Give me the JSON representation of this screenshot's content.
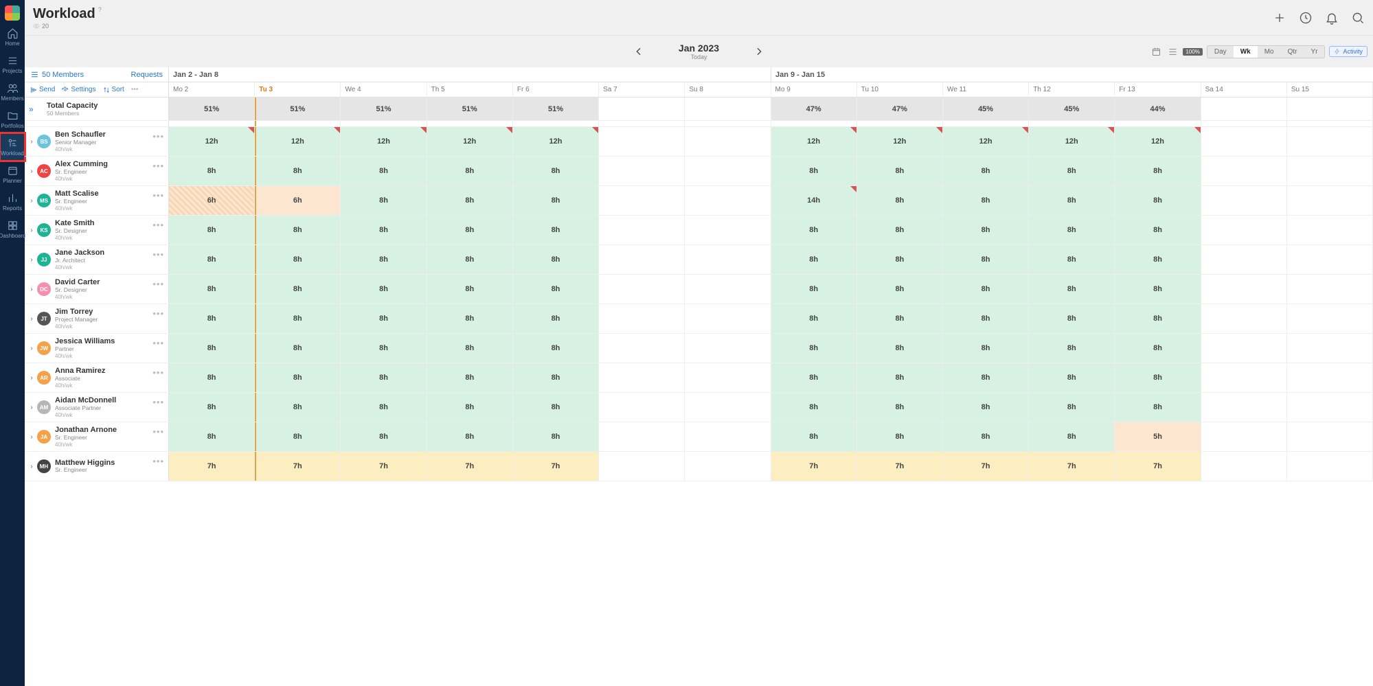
{
  "nav": [
    {
      "label": "Home",
      "icon": "home"
    },
    {
      "label": "Projects",
      "icon": "list"
    },
    {
      "label": "Members",
      "icon": "people"
    },
    {
      "label": "Portfolios",
      "icon": "folder"
    },
    {
      "label": "Workload",
      "icon": "workload",
      "active": true,
      "highlight": true
    },
    {
      "label": "Planner",
      "icon": "planner"
    },
    {
      "label": "Reports",
      "icon": "reports"
    },
    {
      "label": "Dashboard",
      "icon": "dashboard"
    }
  ],
  "page": {
    "title": "Workload",
    "view_count": "20"
  },
  "period": {
    "title": "Jan 2023",
    "subtitle": "Today"
  },
  "zoom": "100%",
  "views": [
    "Day",
    "Wk",
    "Mo",
    "Qtr",
    "Yr"
  ],
  "active_view": "Wk",
  "activity_btn": "Activity",
  "weeks": [
    "Jan 2 - Jan 8",
    "Jan 9 - Jan 15"
  ],
  "members_link": "50 Members",
  "requests_link": "Requests",
  "tools": {
    "send": "Send",
    "settings": "Settings",
    "sort": "Sort"
  },
  "days": [
    {
      "short": "Mo 2"
    },
    {
      "short": "Tu 3",
      "today": true
    },
    {
      "short": "We 4"
    },
    {
      "short": "Th 5"
    },
    {
      "short": "Fr 6"
    },
    {
      "short": "Sa 7"
    },
    {
      "short": "Su 8"
    },
    {
      "short": "Mo 9"
    },
    {
      "short": "Tu 10"
    },
    {
      "short": "We 11"
    },
    {
      "short": "Th 12"
    },
    {
      "short": "Fr 13"
    },
    {
      "short": "Sa 14"
    },
    {
      "short": "Su 15"
    }
  ],
  "capacity": {
    "title": "Total Capacity",
    "sub": "50 Members",
    "cells": [
      "51%",
      "51%",
      "51%",
      "51%",
      "51%",
      "",
      "",
      "47%",
      "47%",
      "45%",
      "45%",
      "44%",
      "",
      ""
    ]
  },
  "members": [
    {
      "name": "Ben Schaufler",
      "role": "Senior Manager",
      "cap": "40h/wk",
      "init": "BS",
      "color": "#6cc3e0",
      "cells": [
        {
          "v": "12h",
          "bg": "green",
          "flag": 1
        },
        {
          "v": "12h",
          "bg": "green",
          "flag": 1
        },
        {
          "v": "12h",
          "bg": "green",
          "flag": 1
        },
        {
          "v": "12h",
          "bg": "green",
          "flag": 1
        },
        {
          "v": "12h",
          "bg": "green",
          "flag": 1
        },
        {
          "v": "",
          "bg": "wknd"
        },
        {
          "v": "",
          "bg": "wknd"
        },
        {
          "v": "12h",
          "bg": "green",
          "flag": 1
        },
        {
          "v": "12h",
          "bg": "green",
          "flag": 1
        },
        {
          "v": "12h",
          "bg": "green",
          "flag": 1
        },
        {
          "v": "12h",
          "bg": "green",
          "flag": 1
        },
        {
          "v": "12h",
          "bg": "green",
          "flag": 1
        },
        {
          "v": "",
          "bg": "wknd"
        },
        {
          "v": "",
          "bg": "wknd"
        }
      ]
    },
    {
      "name": "Alex Cumming",
      "role": "Sr. Engineer",
      "cap": "40h/wk",
      "init": "AC",
      "color": "#e44",
      "cells": [
        {
          "v": "8h",
          "bg": "green"
        },
        {
          "v": "8h",
          "bg": "green"
        },
        {
          "v": "8h",
          "bg": "green"
        },
        {
          "v": "8h",
          "bg": "green"
        },
        {
          "v": "8h",
          "bg": "green"
        },
        {
          "v": "",
          "bg": "wknd"
        },
        {
          "v": "",
          "bg": "wknd"
        },
        {
          "v": "8h",
          "bg": "green"
        },
        {
          "v": "8h",
          "bg": "green"
        },
        {
          "v": "8h",
          "bg": "green"
        },
        {
          "v": "8h",
          "bg": "green"
        },
        {
          "v": "8h",
          "bg": "green"
        },
        {
          "v": "",
          "bg": "wknd"
        },
        {
          "v": "",
          "bg": "wknd"
        }
      ]
    },
    {
      "name": "Matt Scalise",
      "role": "Sr. Engineer",
      "cap": "40h/wk",
      "init": "MS",
      "color": "#1db394",
      "cells": [
        {
          "v": "6h",
          "bg": "ohatch"
        },
        {
          "v": "6h",
          "bg": "orange"
        },
        {
          "v": "8h",
          "bg": "green"
        },
        {
          "v": "8h",
          "bg": "green"
        },
        {
          "v": "8h",
          "bg": "green"
        },
        {
          "v": "",
          "bg": "wknd"
        },
        {
          "v": "",
          "bg": "wknd"
        },
        {
          "v": "14h",
          "bg": "green",
          "flag": 1
        },
        {
          "v": "8h",
          "bg": "green"
        },
        {
          "v": "8h",
          "bg": "green"
        },
        {
          "v": "8h",
          "bg": "green"
        },
        {
          "v": "8h",
          "bg": "green"
        },
        {
          "v": "",
          "bg": "wknd"
        },
        {
          "v": "",
          "bg": "wknd"
        }
      ]
    },
    {
      "name": "Kate Smith",
      "role": "Sr. Designer",
      "cap": "40h/wk",
      "init": "KS",
      "color": "#1db394",
      "cells": [
        {
          "v": "8h",
          "bg": "green"
        },
        {
          "v": "8h",
          "bg": "green"
        },
        {
          "v": "8h",
          "bg": "green"
        },
        {
          "v": "8h",
          "bg": "green"
        },
        {
          "v": "8h",
          "bg": "green"
        },
        {
          "v": "",
          "bg": "wknd"
        },
        {
          "v": "",
          "bg": "wknd"
        },
        {
          "v": "8h",
          "bg": "green"
        },
        {
          "v": "8h",
          "bg": "green"
        },
        {
          "v": "8h",
          "bg": "green"
        },
        {
          "v": "8h",
          "bg": "green"
        },
        {
          "v": "8h",
          "bg": "green"
        },
        {
          "v": "",
          "bg": "wknd"
        },
        {
          "v": "",
          "bg": "wknd"
        }
      ]
    },
    {
      "name": "Jane Jackson",
      "role": "Jr. Architect",
      "cap": "40h/wk",
      "init": "JJ",
      "color": "#1db394",
      "cells": [
        {
          "v": "8h",
          "bg": "green"
        },
        {
          "v": "8h",
          "bg": "green"
        },
        {
          "v": "8h",
          "bg": "green"
        },
        {
          "v": "8h",
          "bg": "green"
        },
        {
          "v": "8h",
          "bg": "green"
        },
        {
          "v": "",
          "bg": "wknd"
        },
        {
          "v": "",
          "bg": "wknd"
        },
        {
          "v": "8h",
          "bg": "green"
        },
        {
          "v": "8h",
          "bg": "green"
        },
        {
          "v": "8h",
          "bg": "green"
        },
        {
          "v": "8h",
          "bg": "green"
        },
        {
          "v": "8h",
          "bg": "green"
        },
        {
          "v": "",
          "bg": "wknd"
        },
        {
          "v": "",
          "bg": "wknd"
        }
      ]
    },
    {
      "name": "David Carter",
      "role": "Sr. Designer",
      "cap": "40h/wk",
      "init": "DC",
      "color": "#f48fb1",
      "cells": [
        {
          "v": "8h",
          "bg": "green"
        },
        {
          "v": "8h",
          "bg": "green"
        },
        {
          "v": "8h",
          "bg": "green"
        },
        {
          "v": "8h",
          "bg": "green"
        },
        {
          "v": "8h",
          "bg": "green"
        },
        {
          "v": "",
          "bg": "wknd"
        },
        {
          "v": "",
          "bg": "wknd"
        },
        {
          "v": "8h",
          "bg": "green"
        },
        {
          "v": "8h",
          "bg": "green"
        },
        {
          "v": "8h",
          "bg": "green"
        },
        {
          "v": "8h",
          "bg": "green"
        },
        {
          "v": "8h",
          "bg": "green"
        },
        {
          "v": "",
          "bg": "wknd"
        },
        {
          "v": "",
          "bg": "wknd"
        }
      ]
    },
    {
      "name": "Jim Torrey",
      "role": "Project Manager",
      "cap": "40h/wk",
      "init": "JT",
      "color": "#555",
      "cells": [
        {
          "v": "8h",
          "bg": "green"
        },
        {
          "v": "8h",
          "bg": "green"
        },
        {
          "v": "8h",
          "bg": "green"
        },
        {
          "v": "8h",
          "bg": "green"
        },
        {
          "v": "8h",
          "bg": "green"
        },
        {
          "v": "",
          "bg": "wknd"
        },
        {
          "v": "",
          "bg": "wknd"
        },
        {
          "v": "8h",
          "bg": "green"
        },
        {
          "v": "8h",
          "bg": "green"
        },
        {
          "v": "8h",
          "bg": "green"
        },
        {
          "v": "8h",
          "bg": "green"
        },
        {
          "v": "8h",
          "bg": "green"
        },
        {
          "v": "",
          "bg": "wknd"
        },
        {
          "v": "",
          "bg": "wknd"
        }
      ]
    },
    {
      "name": "Jessica Williams",
      "role": "Partner",
      "cap": "40h/wk",
      "init": "JW",
      "color": "#f4a14a",
      "cells": [
        {
          "v": "8h",
          "bg": "green"
        },
        {
          "v": "8h",
          "bg": "green"
        },
        {
          "v": "8h",
          "bg": "green"
        },
        {
          "v": "8h",
          "bg": "green"
        },
        {
          "v": "8h",
          "bg": "green"
        },
        {
          "v": "",
          "bg": "wknd"
        },
        {
          "v": "",
          "bg": "wknd"
        },
        {
          "v": "8h",
          "bg": "green"
        },
        {
          "v": "8h",
          "bg": "green"
        },
        {
          "v": "8h",
          "bg": "green"
        },
        {
          "v": "8h",
          "bg": "green"
        },
        {
          "v": "8h",
          "bg": "green"
        },
        {
          "v": "",
          "bg": "wknd"
        },
        {
          "v": "",
          "bg": "wknd"
        }
      ]
    },
    {
      "name": "Anna Ramirez",
      "role": "Associate",
      "cap": "40h/wk",
      "init": "AR",
      "color": "#f4a14a",
      "cells": [
        {
          "v": "8h",
          "bg": "green"
        },
        {
          "v": "8h",
          "bg": "green"
        },
        {
          "v": "8h",
          "bg": "green"
        },
        {
          "v": "8h",
          "bg": "green"
        },
        {
          "v": "8h",
          "bg": "green"
        },
        {
          "v": "",
          "bg": "wknd"
        },
        {
          "v": "",
          "bg": "wknd"
        },
        {
          "v": "8h",
          "bg": "green"
        },
        {
          "v": "8h",
          "bg": "green"
        },
        {
          "v": "8h",
          "bg": "green"
        },
        {
          "v": "8h",
          "bg": "green"
        },
        {
          "v": "8h",
          "bg": "green"
        },
        {
          "v": "",
          "bg": "wknd"
        },
        {
          "v": "",
          "bg": "wknd"
        }
      ]
    },
    {
      "name": "Aidan McDonnell",
      "role": "Associate Partner",
      "cap": "40h/wk",
      "init": "AM",
      "color": "#b6b6b6",
      "cells": [
        {
          "v": "8h",
          "bg": "green"
        },
        {
          "v": "8h",
          "bg": "green"
        },
        {
          "v": "8h",
          "bg": "green"
        },
        {
          "v": "8h",
          "bg": "green"
        },
        {
          "v": "8h",
          "bg": "green"
        },
        {
          "v": "",
          "bg": "wknd"
        },
        {
          "v": "",
          "bg": "wknd"
        },
        {
          "v": "8h",
          "bg": "green"
        },
        {
          "v": "8h",
          "bg": "green"
        },
        {
          "v": "8h",
          "bg": "green"
        },
        {
          "v": "8h",
          "bg": "green"
        },
        {
          "v": "8h",
          "bg": "green"
        },
        {
          "v": "",
          "bg": "wknd"
        },
        {
          "v": "",
          "bg": "wknd"
        }
      ]
    },
    {
      "name": "Jonathan Arnone",
      "role": "Sr. Engineer",
      "cap": "40h/wk",
      "init": "JA",
      "color": "#f4a14a",
      "cells": [
        {
          "v": "8h",
          "bg": "green"
        },
        {
          "v": "8h",
          "bg": "green"
        },
        {
          "v": "8h",
          "bg": "green"
        },
        {
          "v": "8h",
          "bg": "green"
        },
        {
          "v": "8h",
          "bg": "green"
        },
        {
          "v": "",
          "bg": "wknd"
        },
        {
          "v": "",
          "bg": "wknd"
        },
        {
          "v": "8h",
          "bg": "green"
        },
        {
          "v": "8h",
          "bg": "green"
        },
        {
          "v": "8h",
          "bg": "green"
        },
        {
          "v": "8h",
          "bg": "green"
        },
        {
          "v": "5h",
          "bg": "orange"
        },
        {
          "v": "",
          "bg": "wknd"
        },
        {
          "v": "",
          "bg": "wknd"
        }
      ]
    },
    {
      "name": "Matthew Higgins",
      "role": "Sr. Engineer",
      "cap": "",
      "init": "MH",
      "color": "#444",
      "cells": [
        {
          "v": "7h",
          "bg": "yellow"
        },
        {
          "v": "7h",
          "bg": "yellow"
        },
        {
          "v": "7h",
          "bg": "yellow"
        },
        {
          "v": "7h",
          "bg": "yellow"
        },
        {
          "v": "7h",
          "bg": "yellow"
        },
        {
          "v": "",
          "bg": "wknd"
        },
        {
          "v": "",
          "bg": "wknd"
        },
        {
          "v": "7h",
          "bg": "yellow"
        },
        {
          "v": "7h",
          "bg": "yellow"
        },
        {
          "v": "7h",
          "bg": "yellow"
        },
        {
          "v": "7h",
          "bg": "yellow"
        },
        {
          "v": "7h",
          "bg": "yellow"
        },
        {
          "v": "",
          "bg": "wknd"
        },
        {
          "v": "",
          "bg": "wknd"
        }
      ]
    }
  ]
}
